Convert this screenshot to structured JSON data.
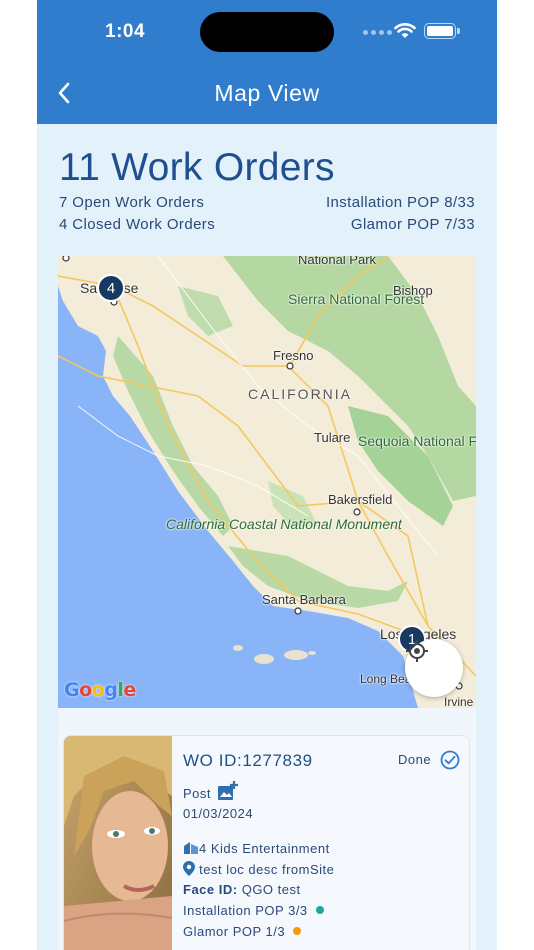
{
  "status_bar": {
    "time": "1:04"
  },
  "nav": {
    "title": "Map View",
    "back_icon": "chevron-left-icon"
  },
  "summary": {
    "title": "11 Work Orders",
    "open": "7 Open Work Orders",
    "closed": "4 Closed Work Orders",
    "installation": "Installation POP 8/33",
    "glamor": "Glamor POP 7/33"
  },
  "map": {
    "labels": {
      "national_park": "National Park",
      "san_jose": "San Jose",
      "bishop": "Bishop",
      "sierra_forest": "Sierra National Forest",
      "fresno": "Fresno",
      "california": "CALIFORNIA",
      "sequoia": "Sequoia National Forest",
      "tulare": "Tulare",
      "bakersfield": "Bakersfield",
      "monument": "California Coastal National Monument",
      "santa_barbara": "Santa Barbara",
      "los_angeles": "Los Angeles",
      "long_beach": "Long Beach",
      "irvine": "Irvine"
    },
    "clusters": {
      "san_jose": "4",
      "los_angeles": "1"
    },
    "google": "Google",
    "colors": {
      "water": "#8ab4f8",
      "land": "#f3ecd8",
      "forest": "#9ccf8f",
      "cluster": "#173a63"
    }
  },
  "work_order": {
    "id": "WO ID:1277839",
    "status": "Done",
    "type": "Post",
    "date": "01/03/2024",
    "company": "4 Kids Entertainment",
    "location": "test loc desc fromSite",
    "face_label": "Face ID:",
    "face_value": "QGO test",
    "installation": "Installation POP 3/3",
    "glamor": "Glamor POP 1/3",
    "colors": {
      "installation_dot": "#1aa89a",
      "glamor_dot": "#f5970f",
      "status": "#2f7dcc"
    }
  }
}
